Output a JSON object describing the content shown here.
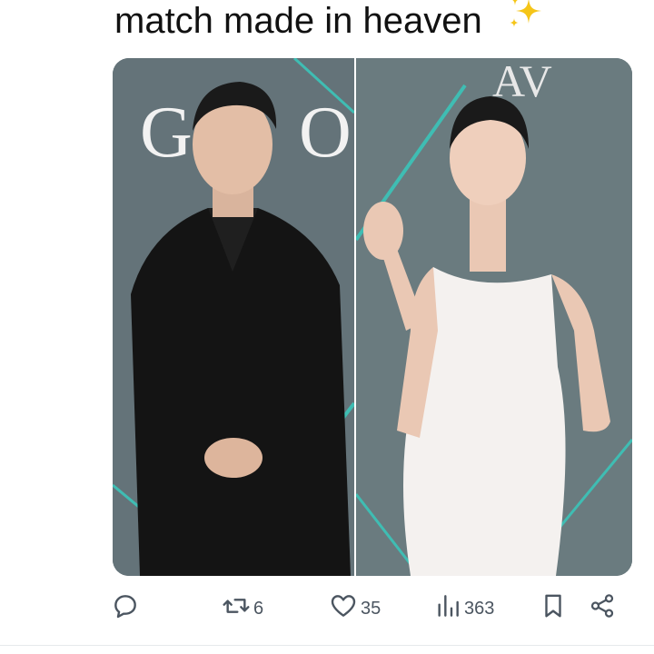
{
  "post": {
    "text": "match made in heaven"
  },
  "media": {
    "left_photo_alt": "man in black suit at awards red carpet",
    "right_photo_alt": "woman in white dress waving at awards red carpet"
  },
  "actions": {
    "reply_count": "",
    "repost_count": "6",
    "like_count": "35",
    "view_count": "363"
  },
  "colors": {
    "icon_gray": "#4b5560",
    "sparkle_yellow": "#f5c518",
    "backdrop_teal": "#3fbdb3"
  },
  "icons": [
    "reply-icon",
    "repost-icon",
    "like-icon",
    "views-icon",
    "bookmark-icon",
    "share-icon",
    "sparkles-icon"
  ]
}
